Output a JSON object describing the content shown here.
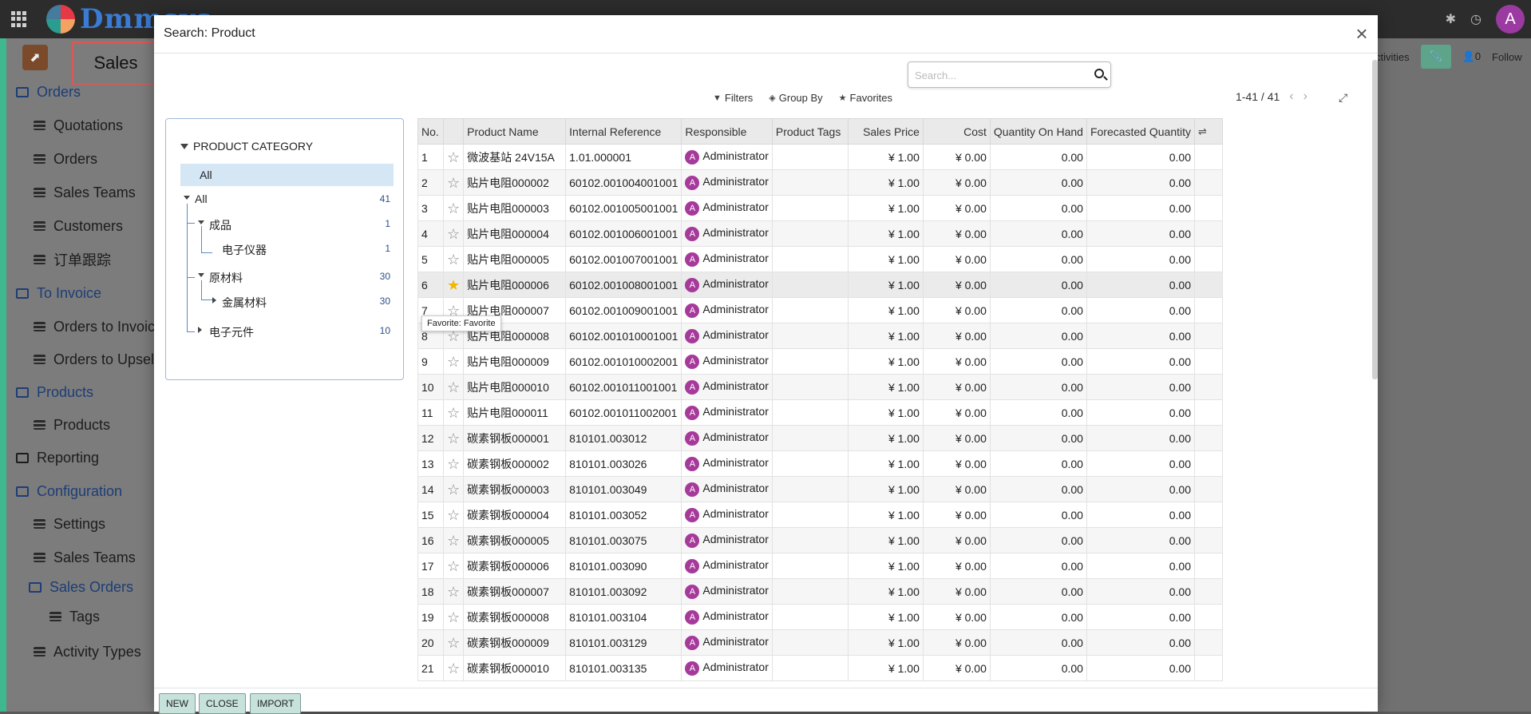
{
  "topbar": {
    "brand": "Dmmsys",
    "avatar_letter": "A"
  },
  "app": {
    "title": "Sales"
  },
  "sidebar": [
    {
      "label": "Orders",
      "kind": "section"
    },
    {
      "label": "Quotations",
      "kind": "sub"
    },
    {
      "label": "Orders",
      "kind": "sub"
    },
    {
      "label": "Sales Teams",
      "kind": "sub"
    },
    {
      "label": "Customers",
      "kind": "sub"
    },
    {
      "label": "订单跟踪",
      "kind": "sub"
    },
    {
      "label": "To Invoice",
      "kind": "section"
    },
    {
      "label": "Orders to Invoice",
      "kind": "sub"
    },
    {
      "label": "Orders to Upsell",
      "kind": "sub"
    },
    {
      "label": "Products",
      "kind": "section"
    },
    {
      "label": "Products",
      "kind": "sub"
    },
    {
      "label": "Reporting",
      "kind": "plain"
    },
    {
      "label": "Configuration",
      "kind": "section"
    },
    {
      "label": "Settings",
      "kind": "sub"
    },
    {
      "label": "Sales Teams",
      "kind": "sub"
    },
    {
      "label": "Sales Orders",
      "kind": "section"
    },
    {
      "label": "Tags",
      "kind": "subsub"
    },
    {
      "label": "Activity Types",
      "kind": "sub"
    }
  ],
  "bg_right": {
    "activities": "ctivities",
    "count": "0",
    "follow": "Follow"
  },
  "modal": {
    "title": "Search: Product",
    "close": "×",
    "search_placeholder": "Search...",
    "filters": "Filters",
    "group_by": "Group By",
    "favorites": "Favorites",
    "pager": "1-41 / 41",
    "tooltip": "Favorite: Favorite",
    "footer": {
      "new": "NEW",
      "close": "CLOSE",
      "import": "IMPORT"
    }
  },
  "category_panel": {
    "title": "PRODUCT CATEGORY",
    "selected": "All",
    "tree": [
      {
        "label": "All",
        "count": "41",
        "level": 0,
        "toggle": "down"
      },
      {
        "label": "成品",
        "count": "1",
        "level": 1,
        "toggle": "down"
      },
      {
        "label": "电子仪器",
        "count": "1",
        "level": 2,
        "toggle": ""
      },
      {
        "label": "原材料",
        "count": "30",
        "level": 1,
        "toggle": "down"
      },
      {
        "label": "金属材料",
        "count": "30",
        "level": 2,
        "toggle": "right"
      },
      {
        "label": "电子元件",
        "count": "10",
        "level": 1,
        "toggle": "right"
      }
    ]
  },
  "table": {
    "columns": [
      "No.",
      "",
      "Product Name",
      "Internal Reference",
      "Responsible",
      "Product Tags",
      "Sales Price",
      "Cost",
      "Quantity On Hand",
      "Forecasted Quantity"
    ],
    "rows": [
      [
        "1",
        "",
        "微波基站 24V15A",
        "1.01.000001",
        "Administrator",
        "",
        "¥ 1.00",
        "¥ 0.00",
        "0.00",
        "0.00"
      ],
      [
        "2",
        "",
        "贴片电阻000002",
        "60102.001004001001",
        "Administrator",
        "",
        "¥ 1.00",
        "¥ 0.00",
        "0.00",
        "0.00"
      ],
      [
        "3",
        "",
        "贴片电阻000003",
        "60102.001005001001",
        "Administrator",
        "",
        "¥ 1.00",
        "¥ 0.00",
        "0.00",
        "0.00"
      ],
      [
        "4",
        "",
        "贴片电阻000004",
        "60102.001006001001",
        "Administrator",
        "",
        "¥ 1.00",
        "¥ 0.00",
        "0.00",
        "0.00"
      ],
      [
        "5",
        "",
        "贴片电阻000005",
        "60102.001007001001",
        "Administrator",
        "",
        "¥ 1.00",
        "¥ 0.00",
        "0.00",
        "0.00"
      ],
      [
        "6",
        "fav",
        "贴片电阻000006",
        "60102.001008001001",
        "Administrator",
        "",
        "¥ 1.00",
        "¥ 0.00",
        "0.00",
        "0.00"
      ],
      [
        "7",
        "",
        "贴片电阻000007",
        "60102.001009001001",
        "Administrator",
        "",
        "¥ 1.00",
        "¥ 0.00",
        "0.00",
        "0.00"
      ],
      [
        "8",
        "",
        "贴片电阻000008",
        "60102.001010001001",
        "Administrator",
        "",
        "¥ 1.00",
        "¥ 0.00",
        "0.00",
        "0.00"
      ],
      [
        "9",
        "",
        "贴片电阻000009",
        "60102.001010002001",
        "Administrator",
        "",
        "¥ 1.00",
        "¥ 0.00",
        "0.00",
        "0.00"
      ],
      [
        "10",
        "",
        "贴片电阻000010",
        "60102.001011001001",
        "Administrator",
        "",
        "¥ 1.00",
        "¥ 0.00",
        "0.00",
        "0.00"
      ],
      [
        "11",
        "",
        "贴片电阻000011",
        "60102.001011002001",
        "Administrator",
        "",
        "¥ 1.00",
        "¥ 0.00",
        "0.00",
        "0.00"
      ],
      [
        "12",
        "",
        "碳素钢板000001",
        "810101.003012",
        "Administrator",
        "",
        "¥ 1.00",
        "¥ 0.00",
        "0.00",
        "0.00"
      ],
      [
        "13",
        "",
        "碳素钢板000002",
        "810101.003026",
        "Administrator",
        "",
        "¥ 1.00",
        "¥ 0.00",
        "0.00",
        "0.00"
      ],
      [
        "14",
        "",
        "碳素钢板000003",
        "810101.003049",
        "Administrator",
        "",
        "¥ 1.00",
        "¥ 0.00",
        "0.00",
        "0.00"
      ],
      [
        "15",
        "",
        "碳素钢板000004",
        "810101.003052",
        "Administrator",
        "",
        "¥ 1.00",
        "¥ 0.00",
        "0.00",
        "0.00"
      ],
      [
        "16",
        "",
        "碳素钢板000005",
        "810101.003075",
        "Administrator",
        "",
        "¥ 1.00",
        "¥ 0.00",
        "0.00",
        "0.00"
      ],
      [
        "17",
        "",
        "碳素钢板000006",
        "810101.003090",
        "Administrator",
        "",
        "¥ 1.00",
        "¥ 0.00",
        "0.00",
        "0.00"
      ],
      [
        "18",
        "",
        "碳素钢板000007",
        "810101.003092",
        "Administrator",
        "",
        "¥ 1.00",
        "¥ 0.00",
        "0.00",
        "0.00"
      ],
      [
        "19",
        "",
        "碳素钢板000008",
        "810101.003104",
        "Administrator",
        "",
        "¥ 1.00",
        "¥ 0.00",
        "0.00",
        "0.00"
      ],
      [
        "20",
        "",
        "碳素钢板000009",
        "810101.003129",
        "Administrator",
        "",
        "¥ 1.00",
        "¥ 0.00",
        "0.00",
        "0.00"
      ],
      [
        "21",
        "",
        "碳素钢板000010",
        "810101.003135",
        "Administrator",
        "",
        "¥ 1.00",
        "¥ 0.00",
        "0.00",
        "0.00"
      ]
    ]
  },
  "colors": {
    "accent": "#3fb88f",
    "avatar": "#a63a9a",
    "favorite_star": "#f1b700",
    "selected_category": "#d5e6f5"
  }
}
